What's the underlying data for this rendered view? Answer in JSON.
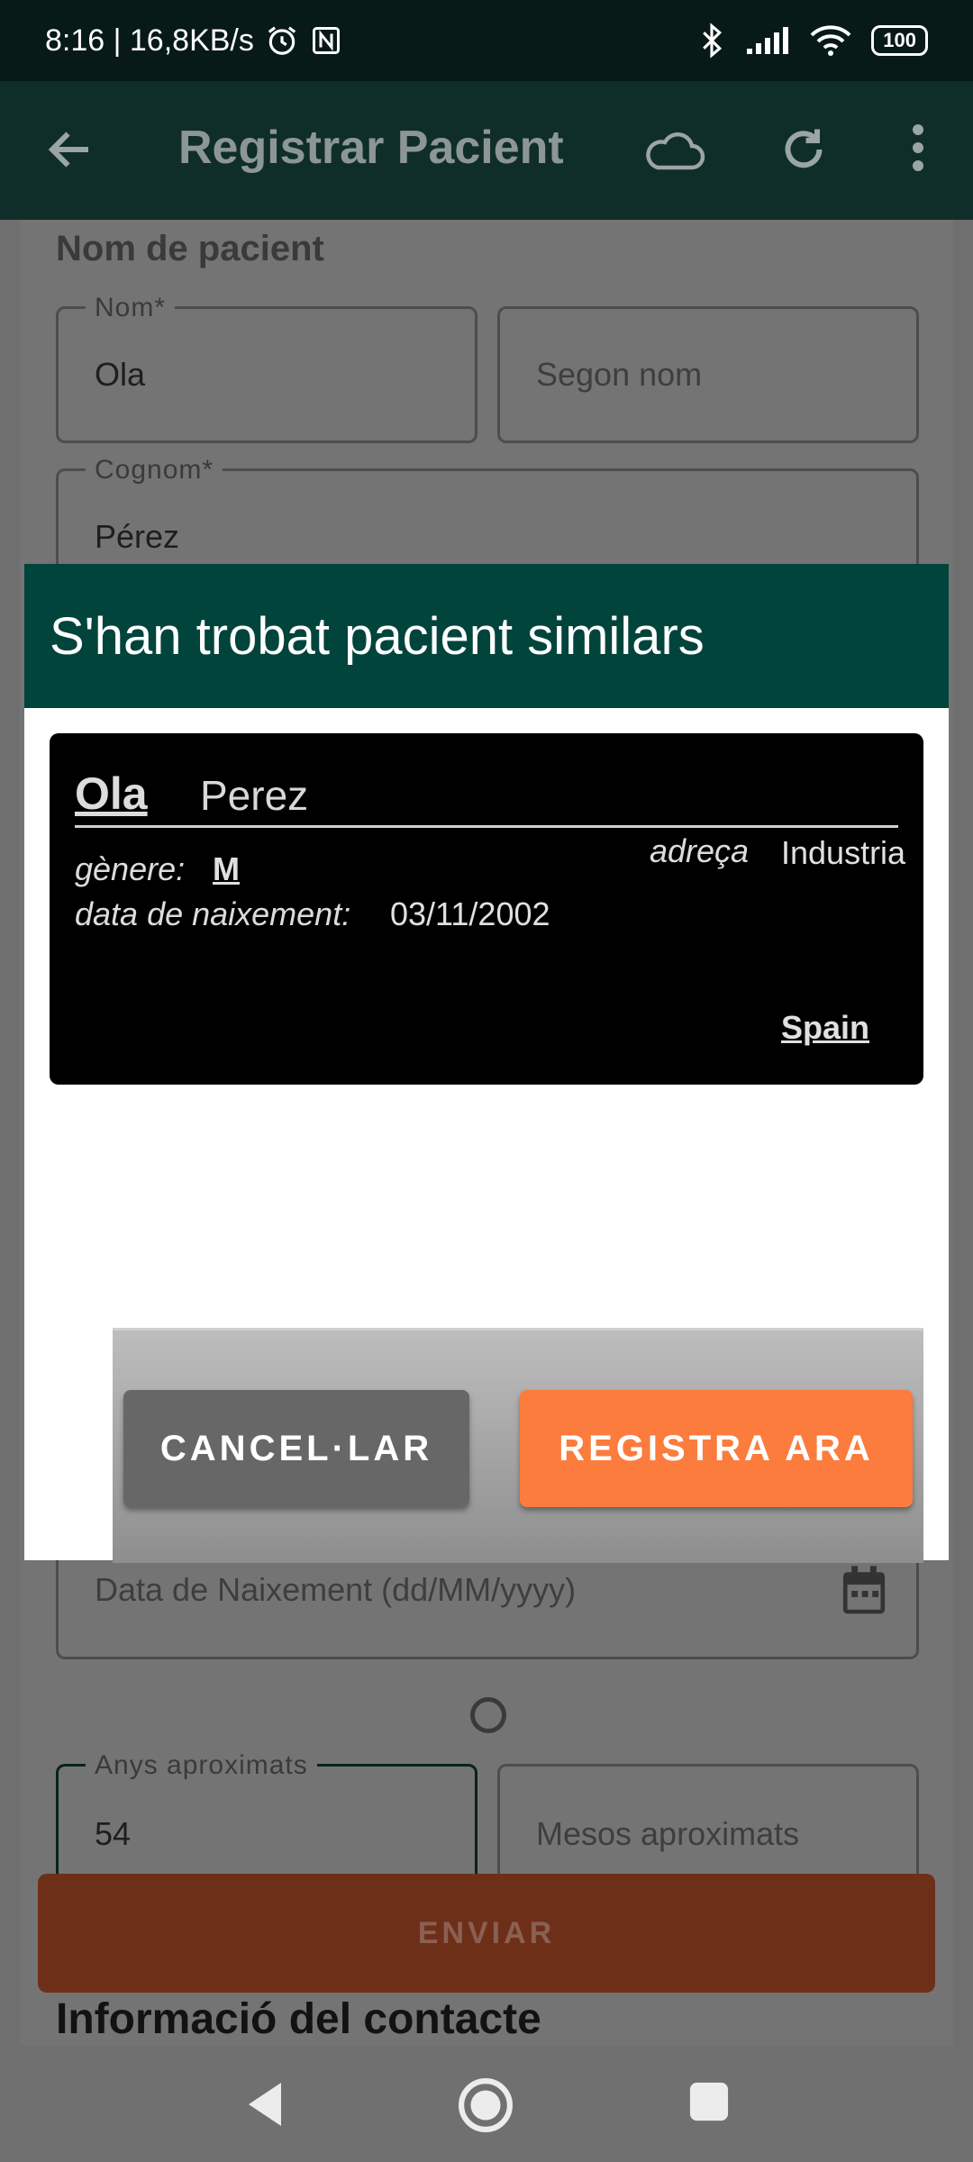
{
  "status_bar": {
    "time_speed": "8:16 | 16,8KB/s",
    "battery": "100"
  },
  "toolbar": {
    "title": "Registrar Pacient"
  },
  "form": {
    "section_name": "Nom de pacient",
    "first_name": {
      "label": "Nom*",
      "value": "Ola"
    },
    "middle_name": {
      "placeholder": "Segon nom"
    },
    "last_name": {
      "label": "Cognom*",
      "value": "Pérez"
    },
    "birth_date": {
      "placeholder": "Data de Naixement (dd/MM/yyyy)"
    },
    "approx_years": {
      "label": "Anys aproximats",
      "value": "54"
    },
    "approx_months": {
      "placeholder": "Mesos aproximats"
    },
    "submit_label": "ENVIAR",
    "contact_section": "Informació del contacte"
  },
  "dialog": {
    "title": "S'han trobat pacient similars",
    "match": {
      "first_name": "Ola",
      "last_name": "Perez",
      "gender_label": "gènere:",
      "gender_value": "M",
      "birth_label": "data de naixement:",
      "birth_value": "03/11/2002",
      "address_label": "adreça",
      "address_value": "Industria",
      "country": "Spain"
    },
    "cancel_label": "CANCEL·LAR",
    "register_label": "REGISTRA ARA"
  },
  "colors": {
    "dialog_header": "#00443c",
    "register_button": "#fb7c3d",
    "cancel_button": "#676767"
  }
}
